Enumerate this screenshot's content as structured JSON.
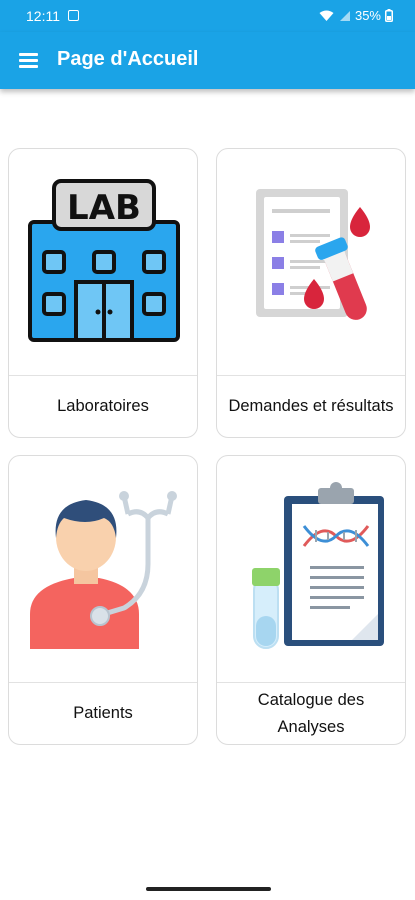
{
  "status_bar": {
    "time": "12:11",
    "battery": "35%"
  },
  "app_bar": {
    "title": "Page d'Accueil",
    "color": "#1aa3e6"
  },
  "cards": [
    {
      "label": "Laboratoires",
      "icon": "laboratory-building-icon"
    },
    {
      "label": "Demandes et résultats",
      "icon": "blood-test-request-icon"
    },
    {
      "label": "Patients",
      "icon": "patient-doctor-icon"
    },
    {
      "label": "Catalogue des Analyses",
      "icon": "analysis-catalogue-clipboard-icon"
    }
  ]
}
